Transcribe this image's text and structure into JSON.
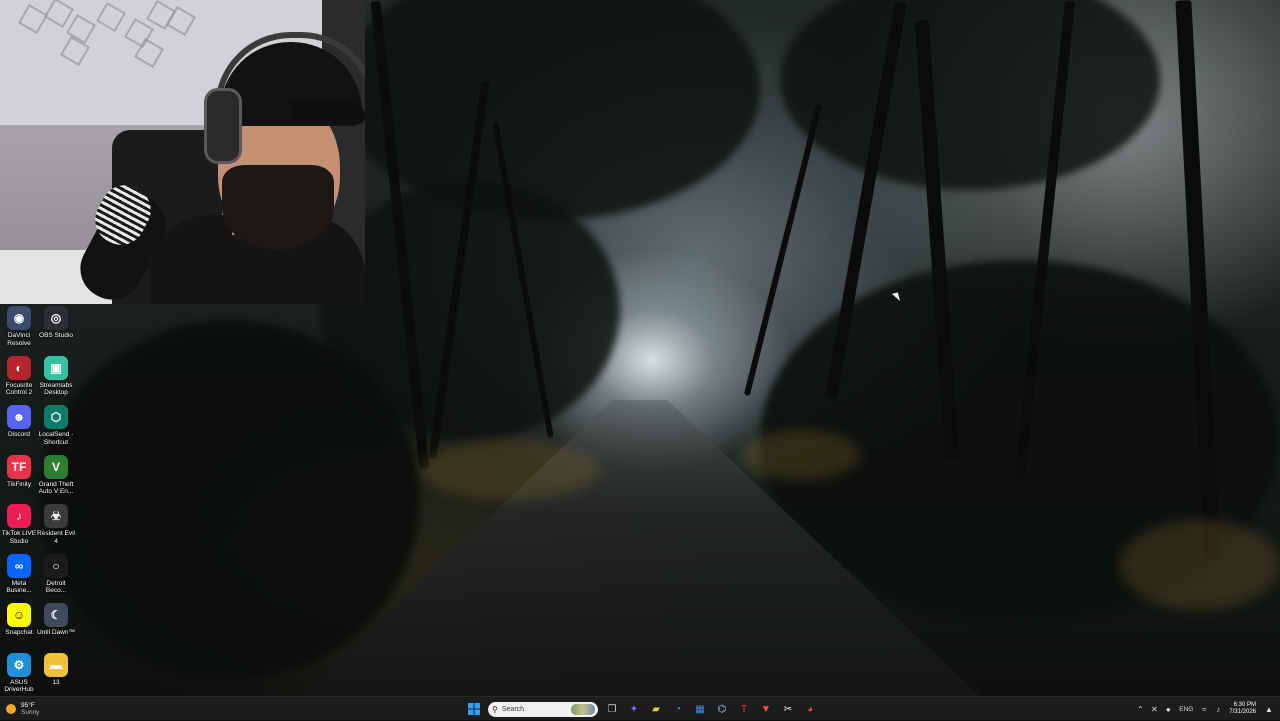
{
  "desktop": {
    "icons": [
      {
        "label": "DaVinci Resolve",
        "icon": "davinci-resolve-icon",
        "color": "#3a4b6b"
      },
      {
        "label": "OBS Studio",
        "icon": "obs-studio-icon",
        "color": "#2d2d35"
      },
      {
        "label": "Focusrite Control 2",
        "icon": "focusrite-icon",
        "color": "#b3262b"
      },
      {
        "label": "Streamlabs Desktop",
        "icon": "streamlabs-icon",
        "color": "#31c3a2"
      },
      {
        "label": "Discord",
        "icon": "discord-icon",
        "color": "#5865f2"
      },
      {
        "label": "LocalSend - Shortcut",
        "icon": "localsend-icon",
        "color": "#0e7c6b"
      },
      {
        "label": "TikFinity",
        "icon": "tikfinity-icon",
        "color": "#e3344a"
      },
      {
        "label": "Grand Theft Auto V En...",
        "icon": "gta-v-icon",
        "color": "#2e7d32"
      },
      {
        "label": "TikTok LIVE Studio",
        "icon": "tiktok-live-icon",
        "color": "#ee1d52"
      },
      {
        "label": "Resident Evil 4",
        "icon": "resident-evil-icon",
        "color": "#3b3b3b"
      },
      {
        "label": "Meta Busine...",
        "icon": "meta-icon",
        "color": "#0866ff"
      },
      {
        "label": "Detroit Beco...",
        "icon": "detroit-icon",
        "color": "#1a1a1a"
      },
      {
        "label": "Snapchat",
        "icon": "snapchat-icon",
        "color": "#fffc00"
      },
      {
        "label": "Until Dawn™",
        "icon": "until-dawn-icon",
        "color": "#3c4a5a"
      },
      {
        "label": "ASUS DriverHub",
        "icon": "asus-driverhub-icon",
        "color": "#1f8fd6"
      },
      {
        "label": "13",
        "icon": "folder-icon",
        "color": "#f0c23b"
      }
    ]
  },
  "taskbar": {
    "weather": {
      "temp": "95°F",
      "condition": "Sunny",
      "icon": "sun-icon"
    },
    "search_placeholder": "Search",
    "apps": [
      {
        "icon": "windows-start-icon",
        "color": "#2aa3ff"
      },
      {
        "icon": "task-view-icon",
        "color": "#cfcfcf"
      },
      {
        "icon": "copilot-icon",
        "color": "#7b6cff"
      },
      {
        "icon": "file-explorer-icon",
        "color": "#f3c33d"
      },
      {
        "icon": "edge-icon",
        "color": "#2fa7e0"
      },
      {
        "icon": "microsoft-store-icon",
        "color": "#3c8ef0"
      },
      {
        "icon": "vscode-icon",
        "color": "#7ad3f7"
      },
      {
        "icon": "tikfinity-icon",
        "color": "#e3344a"
      },
      {
        "icon": "brave-icon",
        "color": "#fb542b"
      },
      {
        "icon": "capcut-icon",
        "color": "#eaeaea"
      },
      {
        "icon": "chrome-icon",
        "color": "#e8453c"
      }
    ],
    "tray": {
      "chevron": "chevron-up-icon",
      "language": "ENG",
      "time": "6:30 PM",
      "date": "7/31/2026"
    }
  }
}
